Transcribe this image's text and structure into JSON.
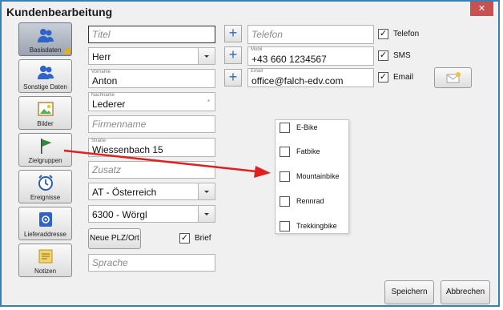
{
  "window": {
    "title": "Kundenbearbeitung",
    "close_glyph": "✕"
  },
  "nav": [
    {
      "label": "Basisdaten",
      "icon": "users-icon",
      "active": true
    },
    {
      "label": "Sonstige Daten",
      "icon": "users-icon"
    },
    {
      "label": "Bilder",
      "icon": "image-icon"
    },
    {
      "label": "Zielgruppen",
      "icon": "flag-icon"
    },
    {
      "label": "Ereignisse",
      "icon": "alarm-clock-icon"
    },
    {
      "label": "Lieferaddresse",
      "icon": "address-card-icon"
    },
    {
      "label": "Notizen",
      "icon": "notes-icon"
    }
  ],
  "form": {
    "titel_placeholder": "Titel",
    "anrede_value": "Herr",
    "vorname_caption": "Vorname",
    "vorname_value": "Anton",
    "nachname_caption": "Nachname",
    "nachname_value": "Lederer",
    "nachname_marker": "*",
    "firmenname_placeholder": "Firmenname",
    "strasse_caption": "Straße",
    "strasse_value": "Wiessenbach 15",
    "zusatz_placeholder": "Zusatz",
    "land_value": "AT - Österreich",
    "plz_value": "6300 - Wörgl",
    "neue_plz_label": "Neue PLZ/Ort",
    "brief_label": "Brief",
    "brief_checked": "✓",
    "sprache_placeholder": "Sprache"
  },
  "contact": {
    "plus_glyph": "+",
    "telefon_placeholder": "Telefon",
    "mobil_caption": "Mobil",
    "mobil_value": "+43 660 1234567",
    "email_caption": "Email",
    "email_value": "office@falch-edv.com",
    "telefon_label": "Telefon",
    "sms_label": "SMS",
    "email_label": "Email",
    "check_glyph": "✓"
  },
  "popup": {
    "items": [
      "E-Bike",
      "Fatbike",
      "Mountainbike",
      "Rennrad",
      "Trekkingbike"
    ]
  },
  "actions": {
    "save_label": "Speichern",
    "cancel_label": "Abbrechen"
  },
  "colors": {
    "frame": "#3c7fb1",
    "close_bg": "#c75050",
    "arrow": "#e0201e",
    "plus_accent": "#2b6cb0"
  }
}
